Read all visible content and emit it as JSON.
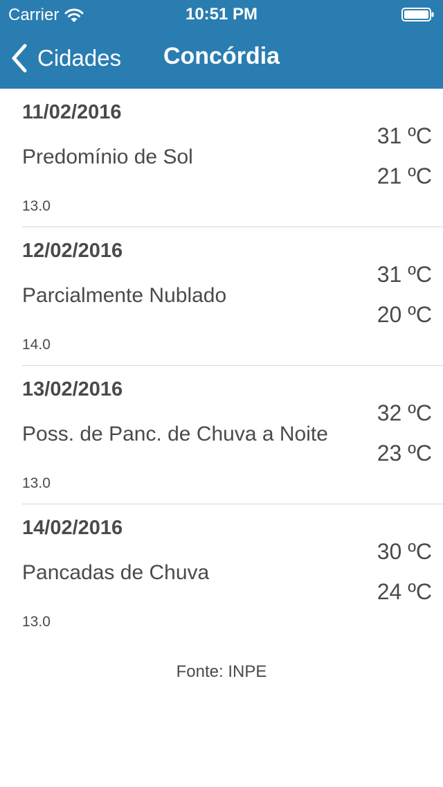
{
  "status_bar": {
    "carrier": "Carrier",
    "time": "10:51 PM",
    "wifi_icon": "wifi-icon",
    "battery_icon": "battery-icon"
  },
  "nav": {
    "back_label": "Cidades",
    "back_icon": "chevron-left-icon",
    "title": "Concórdia",
    "bar_color": "#2a7db0"
  },
  "forecast": [
    {
      "date": "11/02/2016",
      "description": "Predomínio de Sol",
      "uv": "13.0",
      "max": "31 ºC",
      "min": "21 ºC"
    },
    {
      "date": "12/02/2016",
      "description": "Parcialmente Nublado",
      "uv": "14.0",
      "max": "31 ºC",
      "min": "20 ºC"
    },
    {
      "date": "13/02/2016",
      "description": "Poss. de Panc. de Chuva a Noite",
      "uv": "13.0",
      "max": "32 ºC",
      "min": "23 ºC"
    },
    {
      "date": "14/02/2016",
      "description": "Pancadas de Chuva",
      "uv": "13.0",
      "max": "30 ºC",
      "min": "24 ºC"
    }
  ],
  "footer": {
    "source": "Fonte: INPE"
  }
}
